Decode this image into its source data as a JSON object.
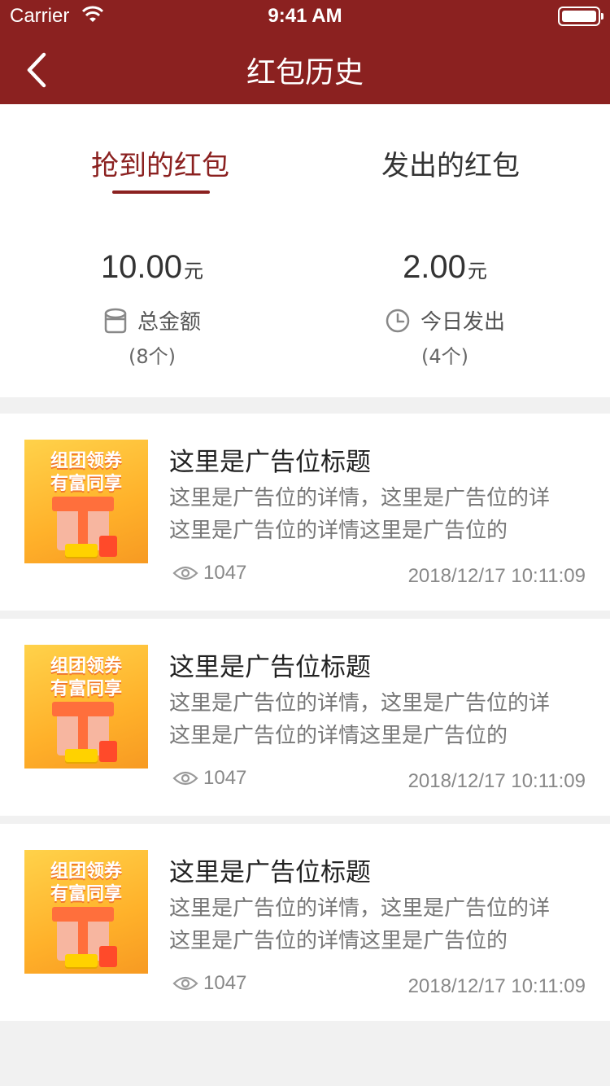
{
  "status_bar": {
    "carrier": "Carrier",
    "time": "9:41 AM"
  },
  "nav": {
    "title": "红包历史"
  },
  "tabs": [
    {
      "label": "抢到的红包",
      "active": true
    },
    {
      "label": "发出的红包",
      "active": false
    }
  ],
  "stats": {
    "total": {
      "amount": "10.00",
      "unit": "元",
      "label": "总金额",
      "count": "(8个)",
      "icon": "wallet-icon"
    },
    "today": {
      "amount": "2.00",
      "unit": "元",
      "label": "今日发出",
      "count": "(4个)",
      "icon": "clock-icon"
    }
  },
  "colors": {
    "brand": "#8b2120",
    "background": "#f1f1f1"
  },
  "items": [
    {
      "thumb_line1": "组团领券",
      "thumb_line2": "有富同享",
      "title": "这里是广告位标题",
      "desc_line1": "这里是广告位的详情，这里是广告位的详",
      "desc_line2": "这里是广告位的详情这里是广告位的",
      "views": "1047",
      "date": "2018/12/17 10:11:09"
    },
    {
      "thumb_line1": "组团领券",
      "thumb_line2": "有富同享",
      "title": "这里是广告位标题",
      "desc_line1": "这里是广告位的详情，这里是广告位的详",
      "desc_line2": "这里是广告位的详情这里是广告位的",
      "views": "1047",
      "date": "2018/12/17 10:11:09"
    },
    {
      "thumb_line1": "组团领券",
      "thumb_line2": "有富同享",
      "title": "这里是广告位标题",
      "desc_line1": "这里是广告位的详情，这里是广告位的详",
      "desc_line2": "这里是广告位的详情这里是广告位的",
      "views": "1047",
      "date": "2018/12/17 10:11:09"
    }
  ]
}
